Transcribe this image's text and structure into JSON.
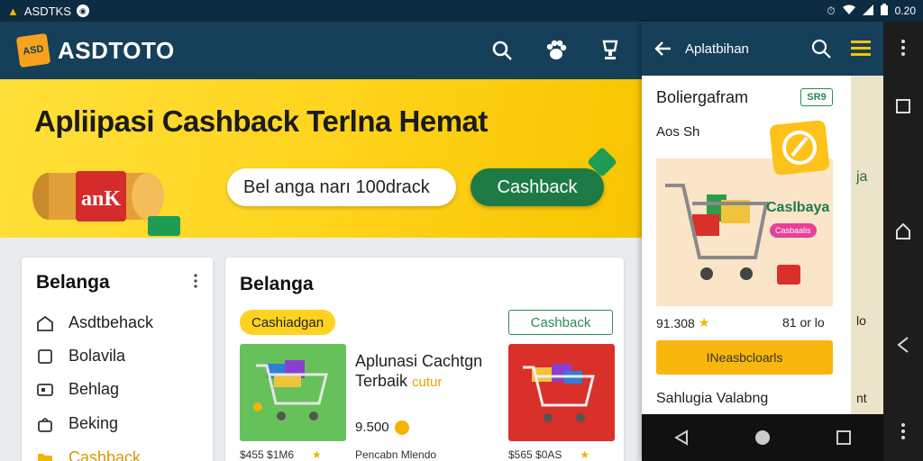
{
  "status_bar": {
    "app_label": "ASDTKS",
    "time": "0.20"
  },
  "appbar": {
    "brand": "ASDTOTO",
    "logo_text": "ASD"
  },
  "hero": {
    "title": "Apliipasi Cashback Terlna Hemat",
    "art_label": "anK",
    "search_text": "Bel anga narı 100drack",
    "cta_label": "Cashback"
  },
  "sidebar": {
    "title": "Belanga",
    "items": [
      {
        "label": "Asdtbehack",
        "icon": "store-icon"
      },
      {
        "label": "Bolavila",
        "icon": "square-icon"
      },
      {
        "label": "Behlag",
        "icon": "ticket-icon"
      },
      {
        "label": "Beking",
        "icon": "bag-icon"
      },
      {
        "label": "Cashback",
        "icon": "folder-icon"
      }
    ]
  },
  "center": {
    "title": "Belanga",
    "chip_yellow": "Cashiadgan",
    "chip_outline": "Cashback",
    "product_title": "Aplunasi Cachtgn Terbaik",
    "product_tag": "cutur",
    "product_price": "9.500",
    "mini_left": "$455 $1M6",
    "mini_center": "Pencabn Mlendo",
    "mini_right": "$565 $0AS"
  },
  "panel": {
    "title": "Aplatbihan",
    "card_title": "Boliergafram",
    "badge": "SR9",
    "sub": "Aos Sh",
    "image_label": "Caslbaya",
    "image_chip": "Casbaalis",
    "price_left": "91.308",
    "price_right": "81 or lo",
    "button": "INeasbcloarls",
    "footer": "Sahlugia Valabng",
    "strip_1": "ja",
    "strip_2": "lo",
    "strip_3": "nt"
  },
  "colors": {
    "appbar": "#163f5a",
    "status": "#0d2c42",
    "hero": "#ffd31a",
    "accent_green": "#1d7a45",
    "accent_yellow": "#f8b70d"
  }
}
